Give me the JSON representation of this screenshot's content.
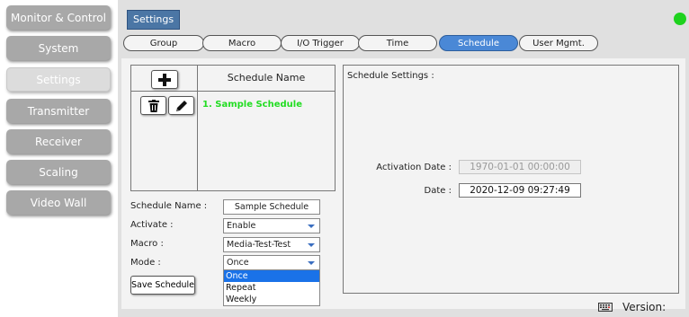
{
  "sidebar": {
    "items": [
      {
        "label": "Monitor & Control",
        "active": false
      },
      {
        "label": "System",
        "active": false
      },
      {
        "label": "Settings",
        "active": true
      },
      {
        "label": "Transmitter",
        "active": false
      },
      {
        "label": "Receiver",
        "active": false
      },
      {
        "label": "Scaling",
        "active": false
      },
      {
        "label": "Video Wall",
        "active": false
      }
    ]
  },
  "header": {
    "section_label": "Settings",
    "status_color": "#1ed21e"
  },
  "tabs": [
    {
      "label": "Group",
      "active": false
    },
    {
      "label": "Macro",
      "active": false
    },
    {
      "label": "I/O Trigger",
      "active": false
    },
    {
      "label": "Time",
      "active": false
    },
    {
      "label": "Schedule",
      "active": true
    },
    {
      "label": "User Mgmt.",
      "active": false
    }
  ],
  "schedule_list": {
    "column_title": "Schedule Name",
    "add_icon": "plus-icon",
    "delete_icon": "trash-icon",
    "edit_icon": "pencil-icon",
    "items": [
      "1. Sample Schedule"
    ]
  },
  "form": {
    "name_label": "Schedule Name :",
    "name_value": "Sample Schedule",
    "activate_label": "Activate :",
    "activate_value": "Enable",
    "macro_label": "Macro :",
    "macro_value": "Media-Test-Test",
    "mode_label": "Mode :",
    "mode_value": "Once",
    "mode_options": [
      "Once",
      "Repeat",
      "Weekly"
    ],
    "save_label": "Save Schedule"
  },
  "schedule_settings": {
    "title": "Schedule Settings :",
    "activation_date_label": "Activation Date :",
    "activation_date_value": "1970-01-01 00:00:00",
    "date_label": "Date :",
    "date_value": "2020-12-09 09:27:49"
  },
  "footer": {
    "keyboard_icon": "keyboard-icon",
    "version_label": "Version:"
  },
  "colors": {
    "accent": "#4a88d6",
    "schedule_item": "#22dd22",
    "selected_option": "#1a72e8"
  }
}
